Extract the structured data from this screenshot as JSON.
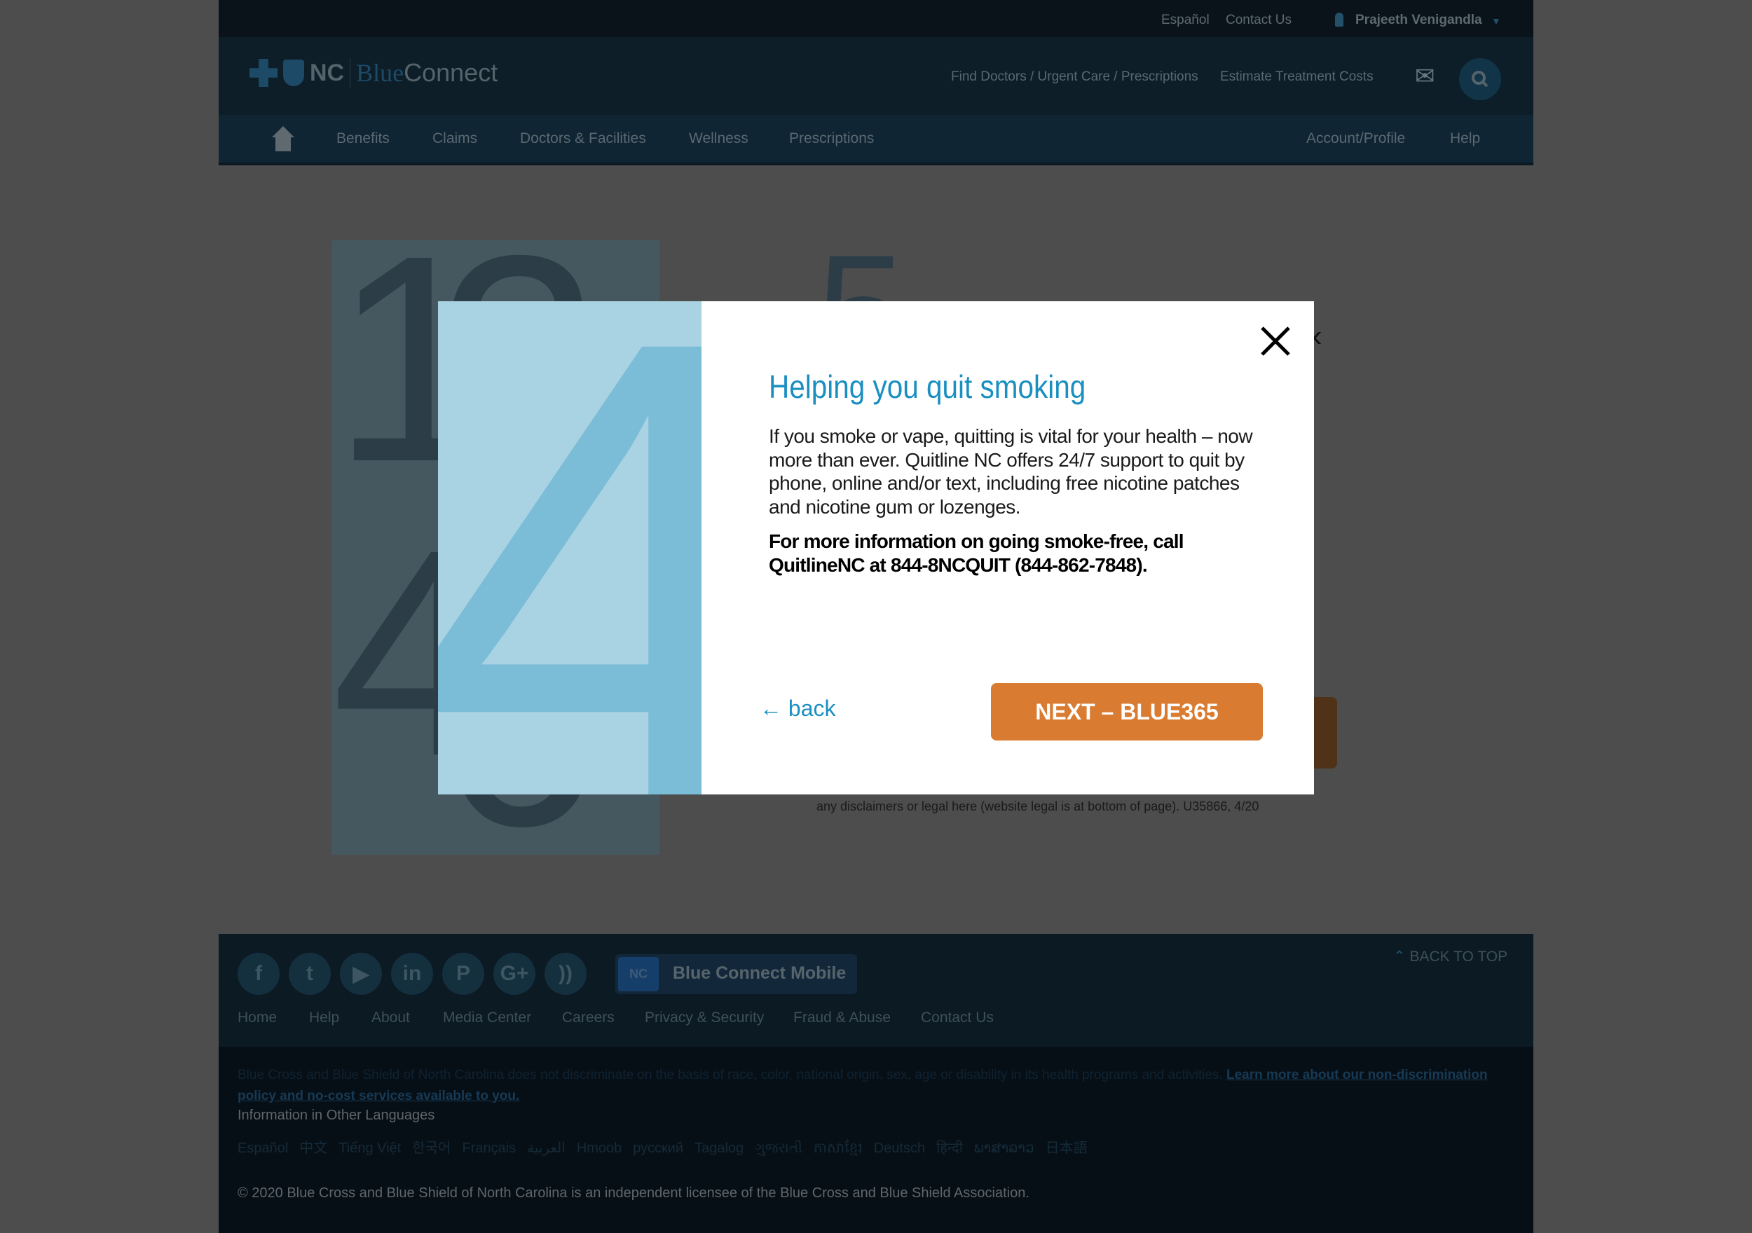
{
  "topbar": {
    "links": [
      "Español",
      "Contact Us"
    ],
    "user": "Prajeeth Venigandla"
  },
  "header": {
    "logo_nc": "NC",
    "logo_blue": "Blue",
    "logo_connect": "Connect",
    "links": [
      "Find Doctors / Urgent Care / Prescriptions",
      "Estimate Treatment Costs"
    ],
    "icons": [
      "mail-icon",
      "search-icon"
    ]
  },
  "nav": {
    "items": [
      "Benefits",
      "Claims",
      "Doctors & Facilities",
      "Wellness",
      "Prescriptions"
    ],
    "right": [
      "Account/Profile",
      "Help"
    ]
  },
  "background": {
    "digits": [
      "1",
      "2",
      "3",
      "4",
      "5",
      "6"
    ],
    "disclaimer": "any disclaimers or legal here (website legal is at bottom of page). U35866, 4/20"
  },
  "modal": {
    "image_digit": "4",
    "title": "Helping you quit smoking",
    "body": "If you smoke or vape, quitting is vital for your health – now more than ever. Quitline NC offers 24/7 support to quit by phone, online and/or text, including free nicotine patches and nicotine gum or lozenges.",
    "bold": "For more information on going smoke-free, call QuitlineNC at 844-8NCQUIT (844-862-7848).",
    "back": "← back",
    "next": "NEXT – BLUE365",
    "colors": {
      "title": "#1a8fc0",
      "button": "#d97b30",
      "image": "#a9d2e2"
    }
  },
  "footer": {
    "social": [
      {
        "icon": "facebook-icon",
        "glyph": "f"
      },
      {
        "icon": "twitter-icon",
        "glyph": "t"
      },
      {
        "icon": "youtube-icon",
        "glyph": "▶"
      },
      {
        "icon": "linkedin-icon",
        "glyph": "in"
      },
      {
        "icon": "pinterest-icon",
        "glyph": "P"
      },
      {
        "icon": "google-plus-icon",
        "glyph": "G+"
      },
      {
        "icon": "rss-icon",
        "glyph": "))"
      }
    ],
    "mobile": "Blue Connect Mobile",
    "mobile_logo": "NC",
    "back_to_top": "BACK TO TOP",
    "links": [
      "Home",
      "Help",
      "About",
      "Media Center",
      "Careers",
      "Privacy & Security",
      "Fraud & Abuse",
      "Contact Us"
    ],
    "nondiscrimination": "Blue Cross and Blue Shield of North Carolina does not discriminate on the basis of race, color, national origin, sex, age or disability in its health programs and activities.",
    "nondiscrimination_link": "Learn more about our non-discrimination policy and no-cost services available to you.",
    "languages_title": "Information in Other Languages",
    "languages": [
      "Español",
      "中文",
      "Tiếng Việt",
      "한국어",
      "Français",
      "العربية",
      "Hmoob",
      "русский",
      "Tagalog",
      "ગુજરાતી",
      "ភាសាខ្មែរ",
      "Deutsch",
      "हिन्दी",
      "ພາສາລາວ",
      "日本語"
    ],
    "copyright": "© 2020 Blue Cross and Blue Shield of North Carolina is an independent licensee of the Blue Cross and Blue Shield Association."
  }
}
